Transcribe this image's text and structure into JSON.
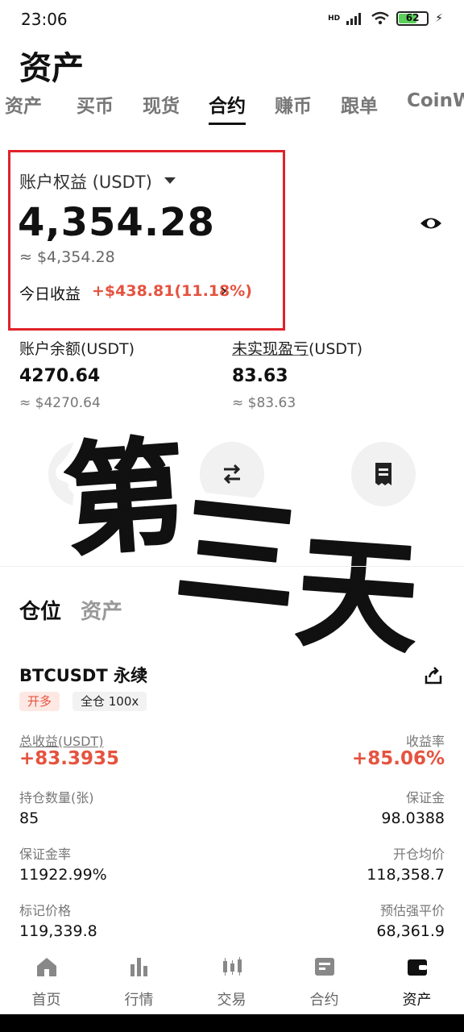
{
  "status_bar": {
    "time": "23:06",
    "network": "HD",
    "battery": "62"
  },
  "page_title": "资产",
  "tabs": [
    "资产",
    "买币",
    "现货",
    "合约",
    "赚币",
    "跟单",
    "CoinW"
  ],
  "active_tab": "合约",
  "equity": {
    "label": "账户权益 (USDT)",
    "value": "4,354.28",
    "approx": "≈ $4,354.28",
    "today_label": "今日收益",
    "today_value": "+$438.81(11.18%)"
  },
  "balances": [
    {
      "label": "账户余额(USDT)",
      "value": "4270.64",
      "approx": "≈ $4270.64"
    },
    {
      "label_underlined": "未实现盈亏",
      "label_suffix": "(USDT)",
      "value": "83.63",
      "approx": "≈ $83.63"
    }
  ],
  "sticker_text": "第三天",
  "section_tabs": [
    "仓位",
    "资产"
  ],
  "position": {
    "pair": "BTCUSDT 永续",
    "badge_side": "开多",
    "badge_margin": "全仓 100x",
    "total_pnl_label": "总收益(USDT)",
    "total_pnl": "+83.3935",
    "roe_label": "收益率",
    "roe": "+85.06%",
    "qty_label": "持仓数量(张)",
    "qty": "85",
    "margin_label": "保证金",
    "margin": "98.0388",
    "margin_ratio_label": "保证金率",
    "margin_ratio": "11922.99%",
    "entry_label": "开仓均价",
    "entry": "118,358.7",
    "mark_label": "标记价格",
    "mark": "119,339.8",
    "liq_label": "预估强平价",
    "liq": "68,361.9"
  },
  "bottom_nav": [
    "首页",
    "行情",
    "交易",
    "合约",
    "资产"
  ],
  "colors": {
    "accent_red": "#e5533f",
    "highlight_border": "#e0232b"
  }
}
